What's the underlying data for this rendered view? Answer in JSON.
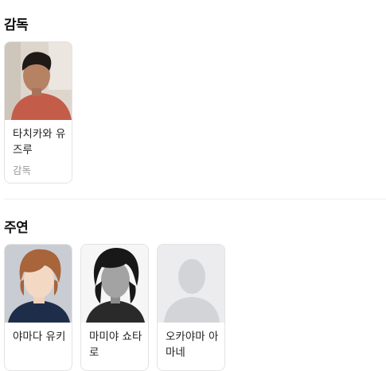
{
  "director_section": {
    "title": "감독",
    "people": [
      {
        "name": "타치카와 유즈루",
        "role": "감독"
      }
    ]
  },
  "cast_section": {
    "title": "주연",
    "people": [
      {
        "name": "야마다 유키"
      },
      {
        "name": "마미야 쇼타로"
      },
      {
        "name": "오카야마 아마네"
      }
    ]
  }
}
